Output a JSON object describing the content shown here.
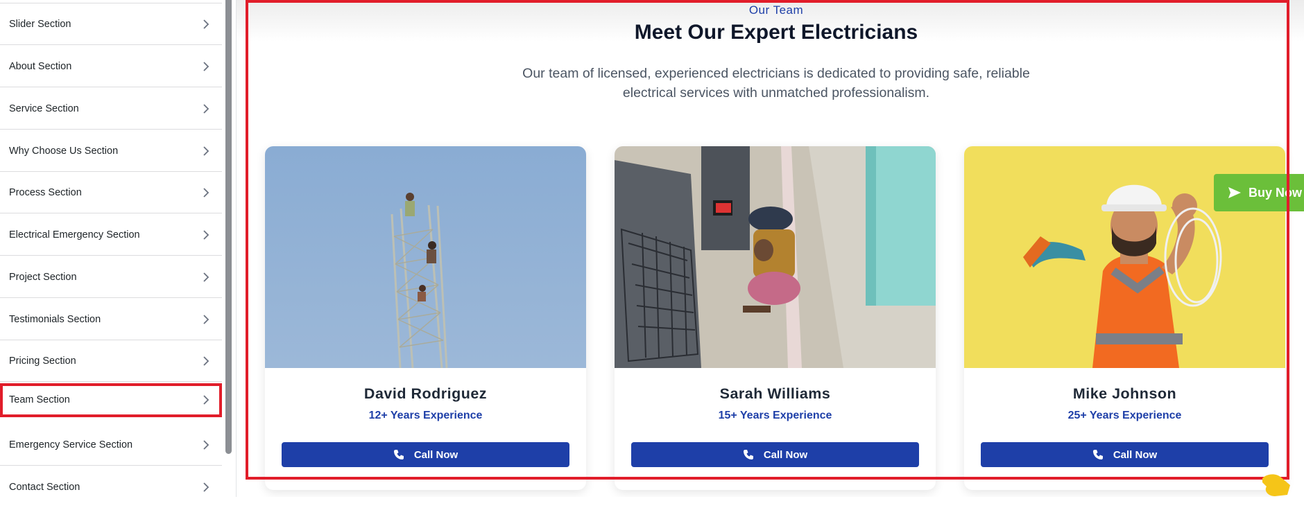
{
  "sidebar": {
    "items": [
      {
        "label": "Slider Section"
      },
      {
        "label": "About Section"
      },
      {
        "label": "Service Section"
      },
      {
        "label": "Why Choose Us Section"
      },
      {
        "label": "Process Section"
      },
      {
        "label": "Electrical Emergency Section"
      },
      {
        "label": "Project Section"
      },
      {
        "label": "Testimonials Section"
      },
      {
        "label": "Pricing Section"
      },
      {
        "label": "Team Section",
        "highlighted": true
      },
      {
        "label": "Emergency Service Section"
      },
      {
        "label": "Contact Section"
      }
    ],
    "chevron_icon": "chevron-right-icon"
  },
  "team": {
    "eyebrow": "Our Team",
    "heading": "Meet Our Expert Electricians",
    "subtext": "Our team of licensed, experienced electricians is dedicated to providing safe, reliable electrical services with unmatched professionalism.",
    "members": [
      {
        "name": "David Rodriguez",
        "experience": "12+ Years Experience",
        "button": "Call Now"
      },
      {
        "name": "Sarah Williams",
        "experience": "15+ Years Experience",
        "button": "Call Now"
      },
      {
        "name": "Mike Johnson",
        "experience": "25+ Years Experience",
        "button": "Call Now"
      }
    ]
  },
  "buy_now": {
    "label": "Buy Now",
    "icon": "send-icon"
  },
  "colors": {
    "accent_blue": "#1e3fa8",
    "buy_green": "#6bbf3a",
    "highlight_red": "#e11d2a",
    "photo1_sky": "#8fb0d4",
    "photo3_bg": "#f1de5c"
  }
}
